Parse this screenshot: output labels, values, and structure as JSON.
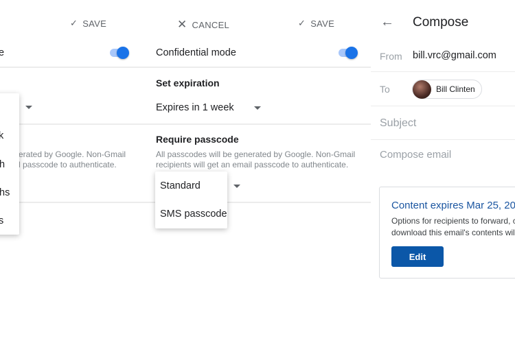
{
  "left_panel": {
    "save_label": "SAVE",
    "confidential_label_clipped": "e",
    "toggle_on": true,
    "description_clipped": [
      "erated by Google. Non-Gmail",
      "l passcode to authenticate."
    ],
    "expiration_menu_items_clipped": [
      "k",
      "th",
      "ths",
      "s"
    ]
  },
  "middle_panel": {
    "cancel_label": "CANCEL",
    "save_label": "SAVE",
    "confidential_label": "Confidential mode",
    "toggle_on": true,
    "expiration_heading": "Set expiration",
    "expiration_value": "Expires in 1 week",
    "passcode_heading": "Require passcode",
    "passcode_description": [
      "All passcodes will be generated by Google. Non-Gmail",
      "recipients will get an email passcode to authenticate."
    ],
    "passcode_menu_items": [
      "Standard",
      "SMS passcode"
    ]
  },
  "compose_panel": {
    "title": "Compose",
    "from_label": "From",
    "from_value": "bill.vrc@gmail.com",
    "to_label": "To",
    "recipient_name": "Bill Clinten",
    "subject_placeholder": "Subject",
    "body_placeholder": "Compose email",
    "card": {
      "title": "Content expires Mar 25, 20",
      "text": [
        "Options for recipients to forward, c",
        "download this email's contents wil"
      ],
      "edit_label": "Edit"
    }
  },
  "colors": {
    "accent": "#1a73e8",
    "card_title": "#1a55a0",
    "edit_button": "#0b57a8"
  }
}
